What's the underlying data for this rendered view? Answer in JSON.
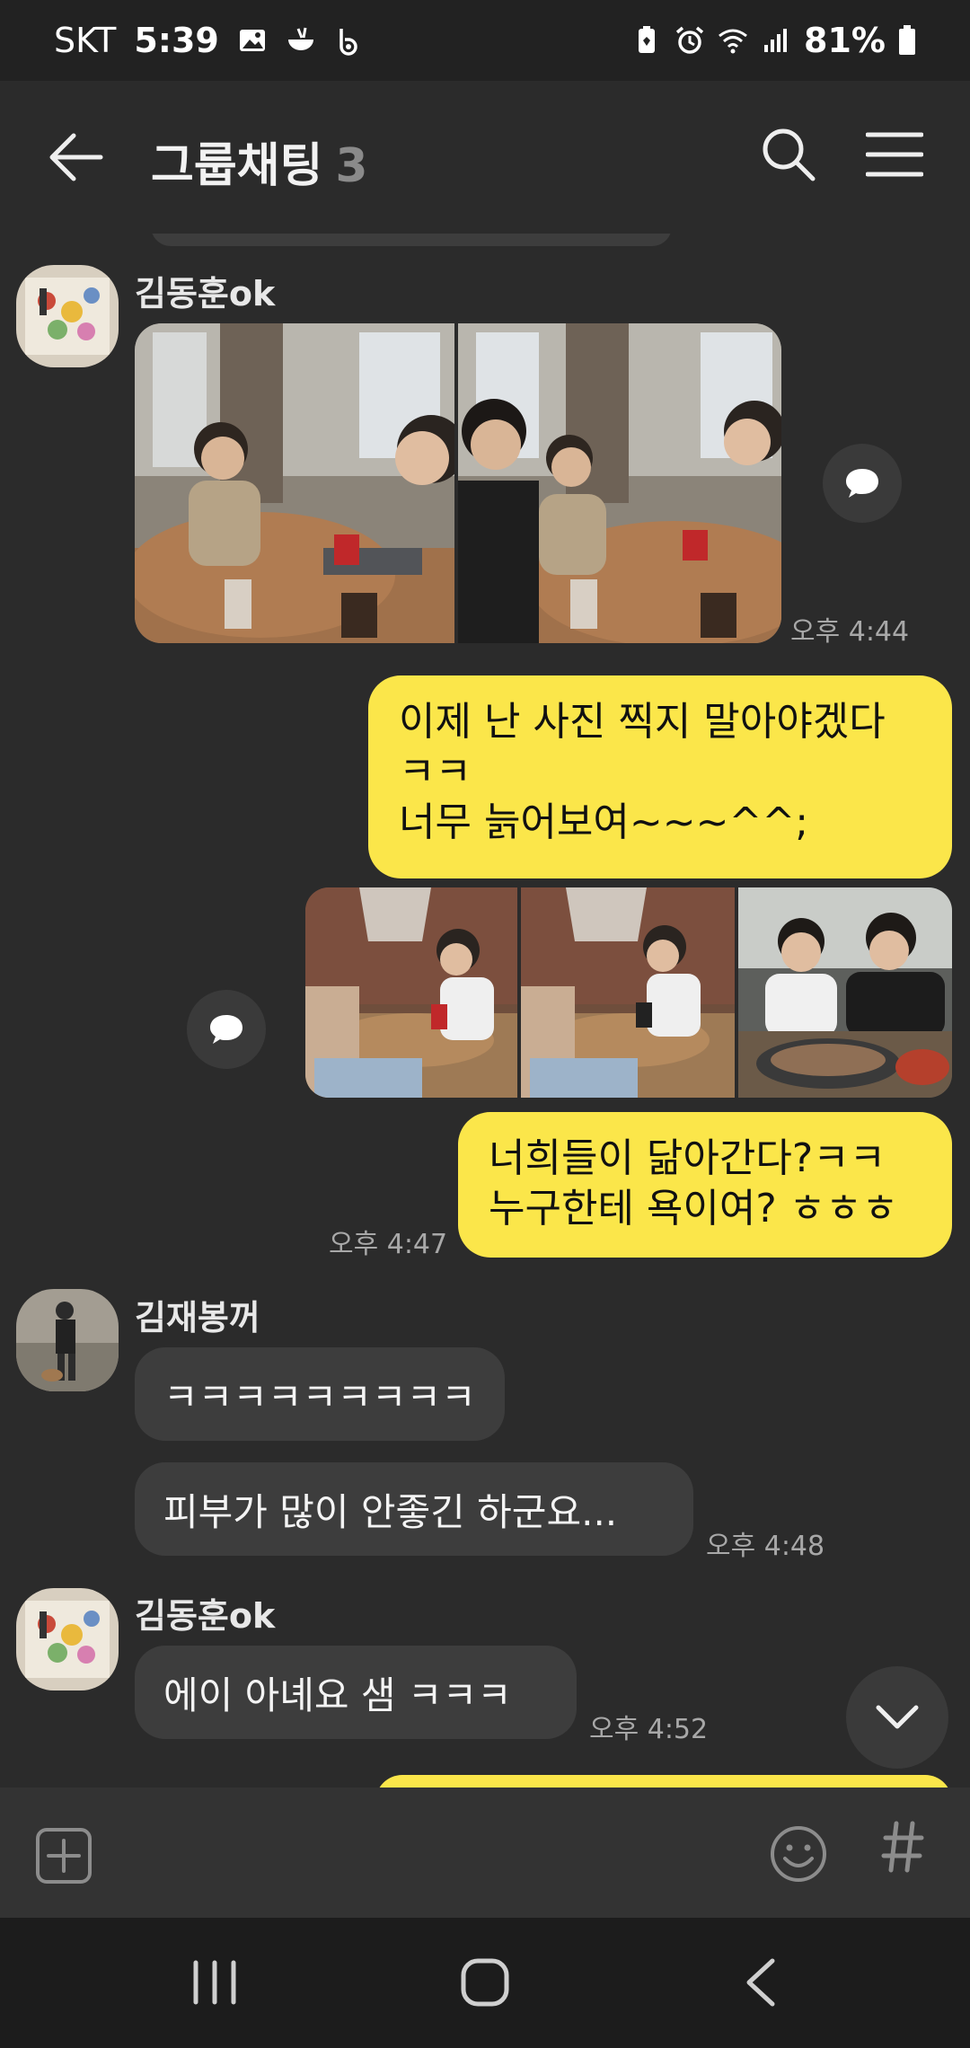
{
  "status_bar": {
    "carrier": "SKT",
    "time": "5:39",
    "battery": "81%"
  },
  "header": {
    "title": "그룹채팅",
    "member_count": "3"
  },
  "messages": {
    "m1": {
      "sender": "김동훈ok",
      "time": "오후 4:44"
    },
    "m2": {
      "lines": [
        "이제 난 사진 찍지 말아야겠다",
        "ㅋㅋ",
        "너무 늙어보여~~~^^;"
      ]
    },
    "m3": {
      "text_lines": [
        "너희들이 닮아간다?ㅋㅋ",
        "누구한테 욕이여? ㅎㅎㅎ"
      ],
      "time": "오후 4:47"
    },
    "m4": {
      "sender": "김재봉꺼",
      "text1": "ㅋㅋㅋㅋㅋㅋㅋㅋㅋ",
      "text2": "피부가 많이 안좋긴 하군요...",
      "time": "오후 4:48"
    },
    "m5": {
      "sender": "김동훈ok",
      "text": "에이 아녜요 샘 ㅋㅋㅋ",
      "time": "오후 4:52"
    }
  },
  "colors": {
    "accent": "#fbe64a",
    "background": "#2b2b2b",
    "incoming_bubble": "#3d3d3d"
  },
  "icons": [
    "back-arrow-icon",
    "search-icon",
    "menu-icon",
    "share-icon",
    "plus-icon",
    "emoji-icon",
    "hash-icon",
    "chevron-down-icon"
  ]
}
